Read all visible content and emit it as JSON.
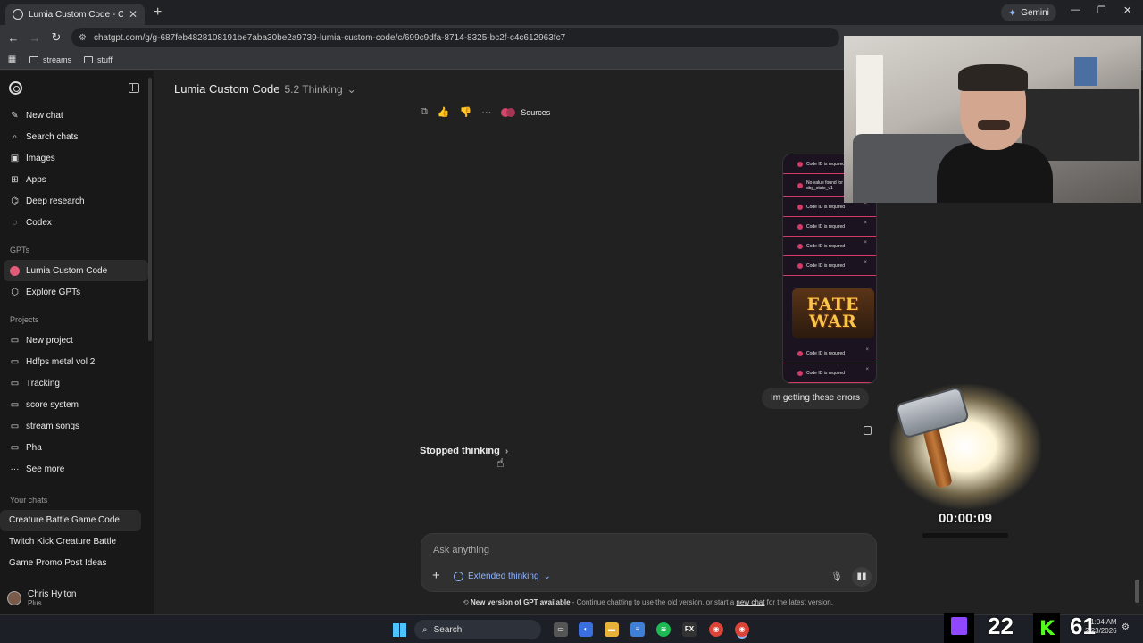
{
  "browser": {
    "tab_title": "Lumia Custom Code - Creature",
    "gemini_label": "Gemini",
    "url": "chatgpt.com/g/g-687feb4828108191be7aba30be2a9739-lumia-custom-code/c/699c9dfa-8714-8325-bc2f-c4c612963fc7",
    "bookmarks": [
      "streams",
      "stuff"
    ]
  },
  "sidebar": {
    "nav": [
      {
        "label": "New chat",
        "icon": "compose-icon"
      },
      {
        "label": "Search chats",
        "icon": "search-icon"
      },
      {
        "label": "Images",
        "icon": "image-icon"
      },
      {
        "label": "Apps",
        "icon": "apps-icon"
      },
      {
        "label": "Deep research",
        "icon": "telescope-icon"
      },
      {
        "label": "Codex",
        "icon": "codex-icon"
      }
    ],
    "gpts_heading": "GPTs",
    "gpts": [
      "Lumia Custom Code",
      "Explore GPTs"
    ],
    "projects_heading": "Projects",
    "projects": [
      "New project",
      "Hdfps metal vol 2",
      "Tracking",
      "score system",
      "stream songs",
      "Pha",
      "See more"
    ],
    "chats_heading": "Your chats",
    "chats": [
      "Creature Battle Game Code",
      "Twitch Kick Creature Battle",
      "Game Promo Post Ideas"
    ],
    "user_name": "Chris Hylton",
    "user_plan": "Plus"
  },
  "main": {
    "model_title": "Lumia Custom Code",
    "model_version": "5.2 Thinking",
    "sources_label": "Sources",
    "user_image": {
      "errors": [
        "Code ID is required",
        "No value found for key cbg_state_v1",
        "Code ID is required",
        "Code ID is required",
        "Code ID is required",
        "Code ID is required"
      ],
      "errors_bottom": [
        "Code ID is required",
        "Code ID is required"
      ],
      "logo_line1": "FATE",
      "logo_line2": "WAR"
    },
    "user_message": "Im getting these errors",
    "stopped_label": "Stopped thinking",
    "composer_placeholder": "Ask anything",
    "extended_label": "Extended thinking",
    "notice_bold": "New version of GPT available",
    "notice_text": " - Continue chatting to use the old version, or start a ",
    "notice_link": "new chat",
    "notice_tail": " for the latest version."
  },
  "overlay": {
    "timer": "00:00:09",
    "viewers_twitch": "22",
    "viewers_kick": "61"
  },
  "taskbar": {
    "search_label": "Search",
    "clock_time": "1:04 AM",
    "clock_date": "2/23/2026"
  },
  "colors": {
    "accent": "#8fb3ff",
    "twitch": "#9146ff",
    "kick": "#53fc18",
    "error": "#d33a66"
  }
}
